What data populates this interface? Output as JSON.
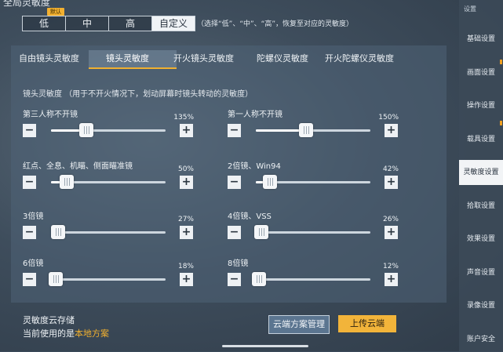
{
  "section_title": "全局灵敏度",
  "presets": {
    "items": [
      "低",
      "中",
      "高",
      "自定义"
    ],
    "active": "自定义",
    "badge": "默认",
    "note": "（选择“低”、“中”、“高”，恢复至对应的灵敏度）"
  },
  "tabs": [
    "自由镜头灵敏度",
    "镜头灵敏度",
    "开火镜头灵敏度",
    "陀螺仪灵敏度",
    "开火陀螺仪灵敏度"
  ],
  "active_tab": "镜头灵敏度",
  "hint": "镜头灵敏度  （用于不开火情况下，划动屏幕时镜头转动的灵敏度）",
  "sliders": [
    {
      "label": "第三人称不开镜",
      "value_text": "135%",
      "level": 0.31
    },
    {
      "label": "第一人称不开镜",
      "value_text": "150%",
      "level": 0.44
    },
    {
      "label": "红点、全息、机瞄、侧面瞄准镜",
      "value_text": "50%",
      "level": 0.14
    },
    {
      "label": "2倍镜、Win94",
      "value_text": "42%",
      "level": 0.12
    },
    {
      "label": "3倍镜",
      "value_text": "27%",
      "level": 0.06
    },
    {
      "label": "4倍镜、VSS",
      "value_text": "26%",
      "level": 0.05
    },
    {
      "label": "6倍镜",
      "value_text": "18%",
      "level": 0.04
    },
    {
      "label": "8倍镜",
      "value_text": "12%",
      "level": 0.03
    }
  ],
  "buttons": {
    "minus": "−",
    "plus": "+"
  },
  "cloud": {
    "title": "灵敏度云存储",
    "current_prefix": "当前使用的是",
    "current_value": "本地方案",
    "manage": "云端方案管理",
    "upload": "上传云端"
  },
  "sidebar": {
    "top": "设置",
    "items": [
      "基础设置",
      "画面设置",
      "操作设置",
      "载具设置",
      "灵敏度设置",
      "拾取设置",
      "效果设置",
      "声音设置",
      "录像设置",
      "账户安全"
    ],
    "active": "灵敏度设置"
  },
  "colors": {
    "accent": "#f0b030",
    "button_light": "#eef1f4"
  }
}
